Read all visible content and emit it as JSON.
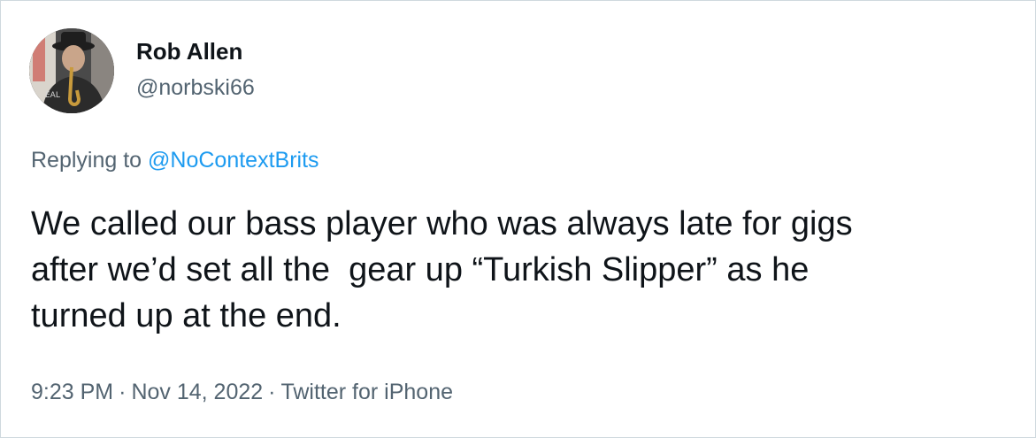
{
  "author": {
    "display_name": "Rob Allen",
    "handle": "@norbski66",
    "avatar_shirt_text": "EAL"
  },
  "reply": {
    "prefix": "Replying to",
    "mention": "@NoContextBrits"
  },
  "tweet": {
    "line1": "We called our bass player who was always late for gigs",
    "line2": "after we’d set all the  gear up “Turkish Slipper” as he",
    "line3": "turned up at the end."
  },
  "meta": {
    "time": "9:23 PM",
    "separator": "·",
    "date": "Nov 14, 2022",
    "source": "Twitter for iPhone"
  },
  "colors": {
    "text_primary": "#0f1419",
    "text_secondary": "#536471",
    "link": "#1d9bf0",
    "border": "#cfd9de"
  }
}
